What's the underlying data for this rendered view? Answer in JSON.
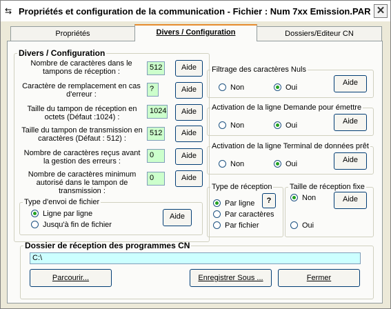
{
  "window": {
    "title": "Propriétés et configuration de la communication - Fichier : Num 7xx Emission.PAR",
    "close": "✕"
  },
  "tabs": [
    "Propriétés",
    "Divers / Configuration",
    "Dossiers/Editeur CN"
  ],
  "divers": {
    "legend": "Divers / Configuration",
    "rows": [
      {
        "label": "Nombre de caractères dans le tampons de réception :",
        "value": "512",
        "button": "Aide"
      },
      {
        "label": "Caractère de remplacement en cas d'erreur :",
        "value": "?",
        "button": "Aide"
      },
      {
        "label": "Taille du tampon de réception en octets (Défaut :1024) :",
        "value": "1024",
        "button": "Aide"
      },
      {
        "label": "Taille du tampon de transmission en caractères (Défaut : 512) :",
        "value": "512",
        "button": "Aide"
      },
      {
        "label": "Nombre de caractères reçus avant la gestion des erreurs :",
        "value": "0",
        "button": "Aide"
      },
      {
        "label": "Nombre de caractères minimum autorisé dans le tampon de transmission :",
        "value": "0",
        "button": "Aide"
      }
    ],
    "send_type": {
      "legend": "Type d'envoi de fichier",
      "option1": "Ligne par ligne",
      "option2": "Jusqu'à fin de fichier",
      "button": "Aide"
    }
  },
  "filtrage": {
    "legend": "Filtrage des caractères Nuls",
    "non": "Non",
    "oui": "Oui",
    "button": "Aide"
  },
  "demande": {
    "legend": "Activation de la ligne Demande pour émettre",
    "non": "Non",
    "oui": "Oui",
    "button": "Aide"
  },
  "terminal": {
    "legend": "Activation de la ligne Terminal de données prêt",
    "non": "Non",
    "oui": "Oui",
    "button": "Aide"
  },
  "reception_type": {
    "legend": "Type de réception",
    "option1": "Par ligne",
    "option2": "Par caractères",
    "option3": "Par fichier",
    "help": "?"
  },
  "taille_fixe": {
    "legend": "Taille de réception fixe",
    "non": "Non",
    "oui": "Oui",
    "button": "Aide"
  },
  "dossier": {
    "legend": "Dossier de réception des programmes CN",
    "path": "C:\\"
  },
  "buttons": {
    "browse": "Parcourir...",
    "save_as": "Enregistrer Sous ...",
    "close": "Fermer"
  }
}
